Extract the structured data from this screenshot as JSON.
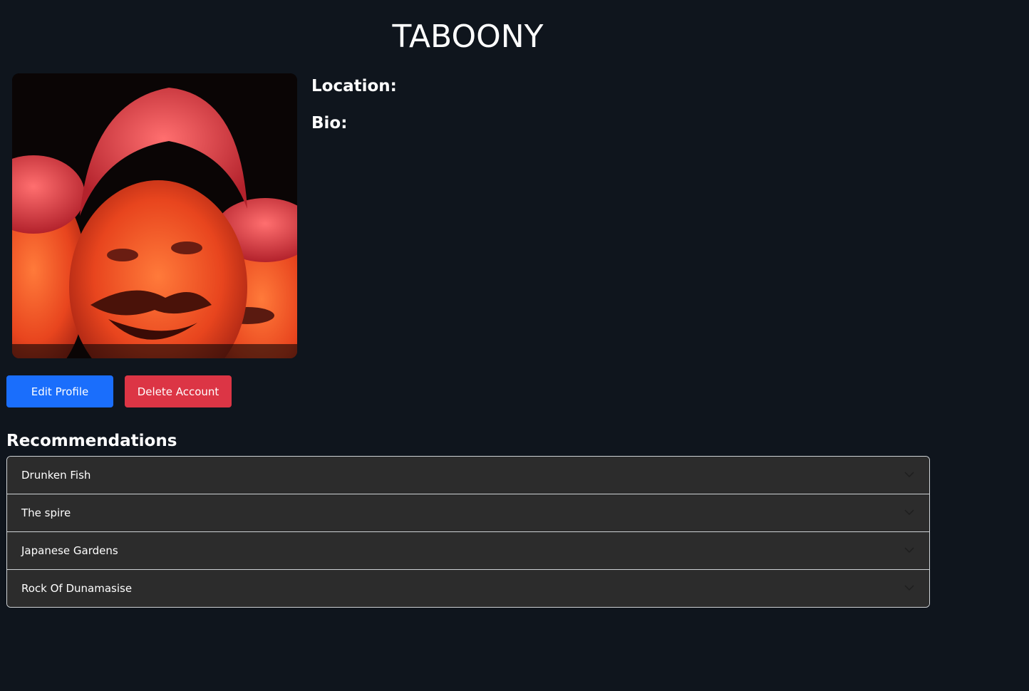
{
  "profile": {
    "username": "TABOONY",
    "location_label": "Location:",
    "bio_label": "Bio:",
    "avatar_icon": "avatar-image"
  },
  "actions": {
    "edit_label": "Edit Profile",
    "delete_label": "Delete Account"
  },
  "recommendations": {
    "heading": "Recommendations",
    "items": [
      {
        "label": "Drunken Fish"
      },
      {
        "label": "The spire"
      },
      {
        "label": "Japanese Gardens"
      },
      {
        "label": "Rock Of Dunamasise"
      }
    ]
  },
  "colors": {
    "background": "#0f151d",
    "primary": "#1a6efc",
    "danger": "#dc3545",
    "accordion_bg": "#2c2c2c",
    "border": "#cfd3d6"
  }
}
